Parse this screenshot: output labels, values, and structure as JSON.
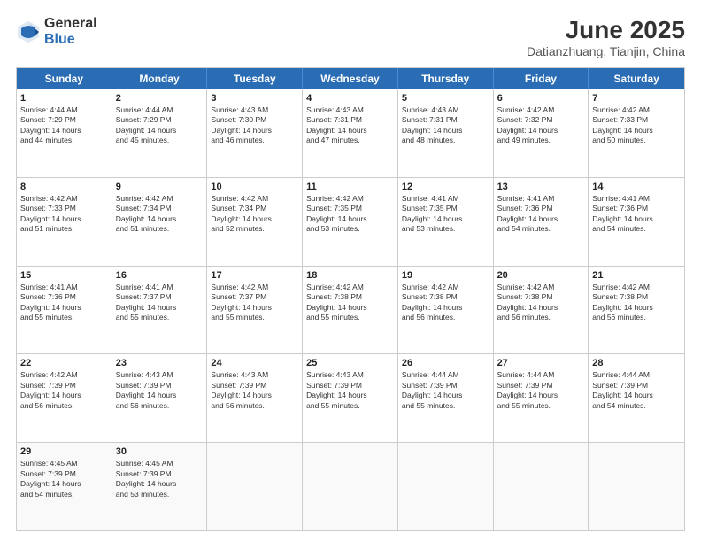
{
  "logo": {
    "general": "General",
    "blue": "Blue"
  },
  "title": "June 2025",
  "subtitle": "Datianzhuang, Tianjin, China",
  "headers": [
    "Sunday",
    "Monday",
    "Tuesday",
    "Wednesday",
    "Thursday",
    "Friday",
    "Saturday"
  ],
  "rows": [
    [
      {
        "day": "1",
        "info": "Sunrise: 4:44 AM\nSunset: 7:29 PM\nDaylight: 14 hours\nand 44 minutes."
      },
      {
        "day": "2",
        "info": "Sunrise: 4:44 AM\nSunset: 7:29 PM\nDaylight: 14 hours\nand 45 minutes."
      },
      {
        "day": "3",
        "info": "Sunrise: 4:43 AM\nSunset: 7:30 PM\nDaylight: 14 hours\nand 46 minutes."
      },
      {
        "day": "4",
        "info": "Sunrise: 4:43 AM\nSunset: 7:31 PM\nDaylight: 14 hours\nand 47 minutes."
      },
      {
        "day": "5",
        "info": "Sunrise: 4:43 AM\nSunset: 7:31 PM\nDaylight: 14 hours\nand 48 minutes."
      },
      {
        "day": "6",
        "info": "Sunrise: 4:42 AM\nSunset: 7:32 PM\nDaylight: 14 hours\nand 49 minutes."
      },
      {
        "day": "7",
        "info": "Sunrise: 4:42 AM\nSunset: 7:33 PM\nDaylight: 14 hours\nand 50 minutes."
      }
    ],
    [
      {
        "day": "8",
        "info": "Sunrise: 4:42 AM\nSunset: 7:33 PM\nDaylight: 14 hours\nand 51 minutes."
      },
      {
        "day": "9",
        "info": "Sunrise: 4:42 AM\nSunset: 7:34 PM\nDaylight: 14 hours\nand 51 minutes."
      },
      {
        "day": "10",
        "info": "Sunrise: 4:42 AM\nSunset: 7:34 PM\nDaylight: 14 hours\nand 52 minutes."
      },
      {
        "day": "11",
        "info": "Sunrise: 4:42 AM\nSunset: 7:35 PM\nDaylight: 14 hours\nand 53 minutes."
      },
      {
        "day": "12",
        "info": "Sunrise: 4:41 AM\nSunset: 7:35 PM\nDaylight: 14 hours\nand 53 minutes."
      },
      {
        "day": "13",
        "info": "Sunrise: 4:41 AM\nSunset: 7:36 PM\nDaylight: 14 hours\nand 54 minutes."
      },
      {
        "day": "14",
        "info": "Sunrise: 4:41 AM\nSunset: 7:36 PM\nDaylight: 14 hours\nand 54 minutes."
      }
    ],
    [
      {
        "day": "15",
        "info": "Sunrise: 4:41 AM\nSunset: 7:36 PM\nDaylight: 14 hours\nand 55 minutes."
      },
      {
        "day": "16",
        "info": "Sunrise: 4:41 AM\nSunset: 7:37 PM\nDaylight: 14 hours\nand 55 minutes."
      },
      {
        "day": "17",
        "info": "Sunrise: 4:42 AM\nSunset: 7:37 PM\nDaylight: 14 hours\nand 55 minutes."
      },
      {
        "day": "18",
        "info": "Sunrise: 4:42 AM\nSunset: 7:38 PM\nDaylight: 14 hours\nand 55 minutes."
      },
      {
        "day": "19",
        "info": "Sunrise: 4:42 AM\nSunset: 7:38 PM\nDaylight: 14 hours\nand 56 minutes."
      },
      {
        "day": "20",
        "info": "Sunrise: 4:42 AM\nSunset: 7:38 PM\nDaylight: 14 hours\nand 56 minutes."
      },
      {
        "day": "21",
        "info": "Sunrise: 4:42 AM\nSunset: 7:38 PM\nDaylight: 14 hours\nand 56 minutes."
      }
    ],
    [
      {
        "day": "22",
        "info": "Sunrise: 4:42 AM\nSunset: 7:39 PM\nDaylight: 14 hours\nand 56 minutes."
      },
      {
        "day": "23",
        "info": "Sunrise: 4:43 AM\nSunset: 7:39 PM\nDaylight: 14 hours\nand 56 minutes."
      },
      {
        "day": "24",
        "info": "Sunrise: 4:43 AM\nSunset: 7:39 PM\nDaylight: 14 hours\nand 56 minutes."
      },
      {
        "day": "25",
        "info": "Sunrise: 4:43 AM\nSunset: 7:39 PM\nDaylight: 14 hours\nand 55 minutes."
      },
      {
        "day": "26",
        "info": "Sunrise: 4:44 AM\nSunset: 7:39 PM\nDaylight: 14 hours\nand 55 minutes."
      },
      {
        "day": "27",
        "info": "Sunrise: 4:44 AM\nSunset: 7:39 PM\nDaylight: 14 hours\nand 55 minutes."
      },
      {
        "day": "28",
        "info": "Sunrise: 4:44 AM\nSunset: 7:39 PM\nDaylight: 14 hours\nand 54 minutes."
      }
    ],
    [
      {
        "day": "29",
        "info": "Sunrise: 4:45 AM\nSunset: 7:39 PM\nDaylight: 14 hours\nand 54 minutes."
      },
      {
        "day": "30",
        "info": "Sunrise: 4:45 AM\nSunset: 7:39 PM\nDaylight: 14 hours\nand 53 minutes."
      },
      {
        "day": "",
        "info": ""
      },
      {
        "day": "",
        "info": ""
      },
      {
        "day": "",
        "info": ""
      },
      {
        "day": "",
        "info": ""
      },
      {
        "day": "",
        "info": ""
      }
    ]
  ]
}
